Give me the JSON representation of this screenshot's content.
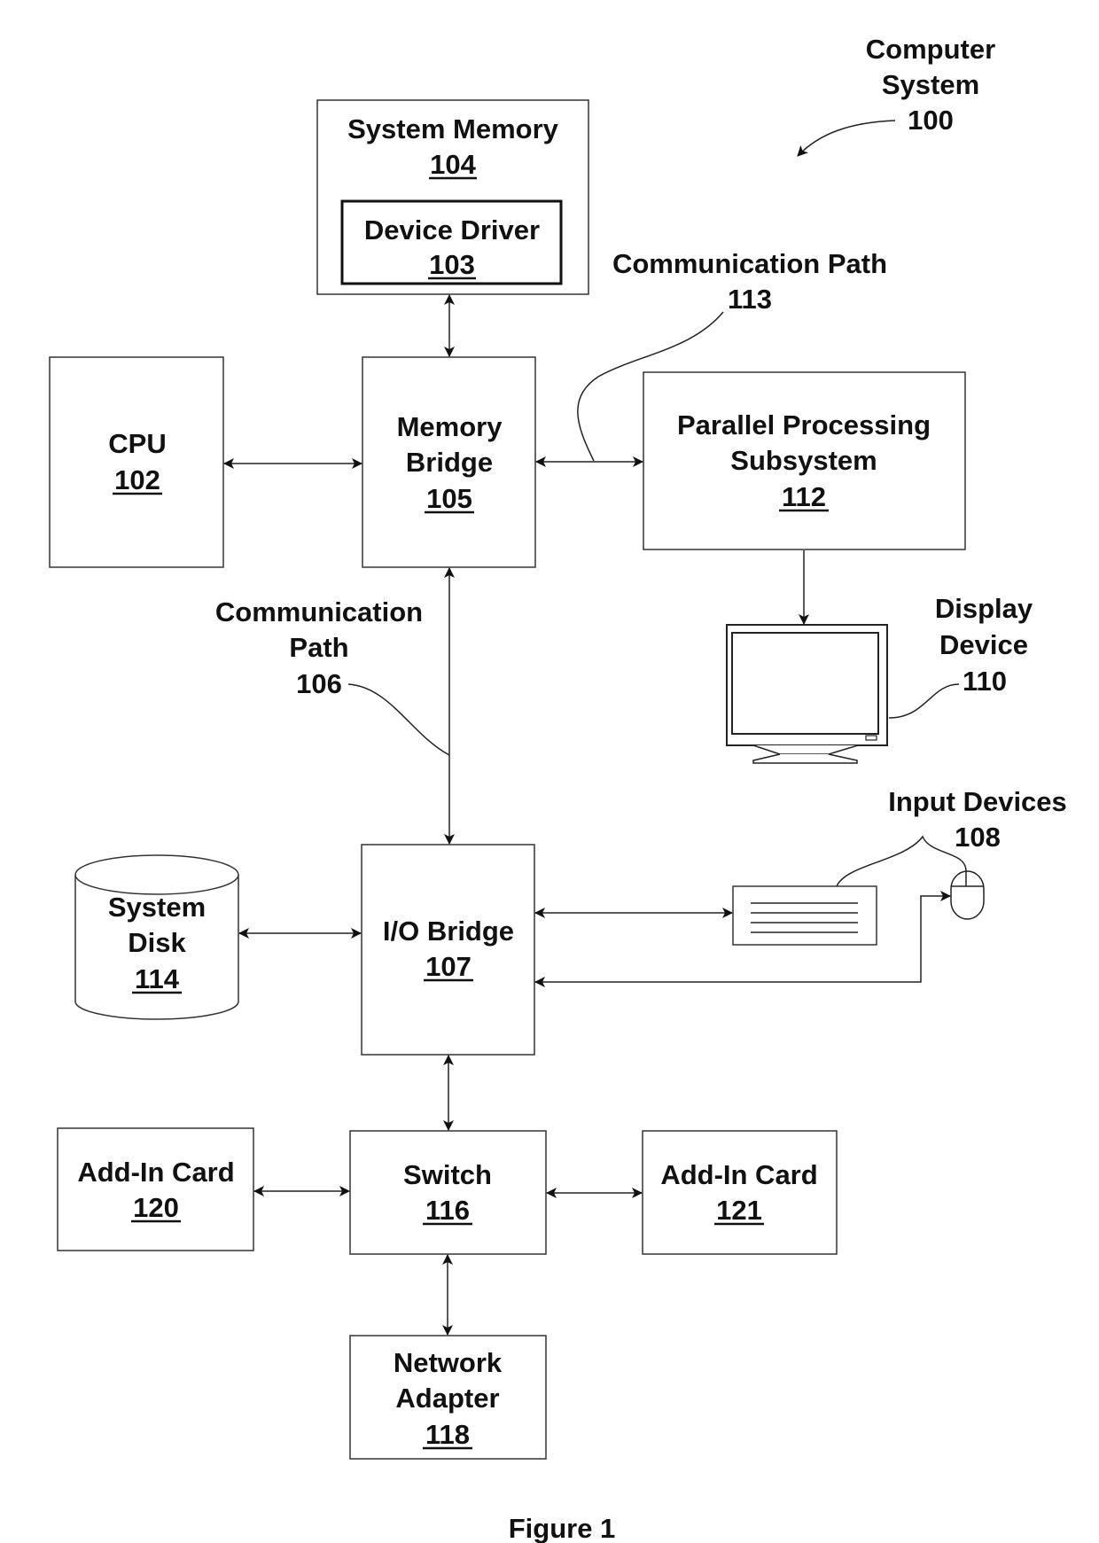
{
  "figure_caption": "Figure 1",
  "system_label": {
    "line1": "Computer",
    "line2": "System",
    "ref": "100"
  },
  "components": {
    "system_memory": {
      "name": "System Memory",
      "ref": "104"
    },
    "device_driver": {
      "name": "Device Driver",
      "ref": "103"
    },
    "cpu": {
      "name": "CPU",
      "ref": "102"
    },
    "memory_bridge": {
      "line1": "Memory",
      "line2": "Bridge",
      "ref": "105"
    },
    "parallel_processing": {
      "line1": "Parallel Processing",
      "line2": "Subsystem",
      "ref": "112"
    },
    "display_device": {
      "line1": "Display",
      "line2": "Device",
      "ref": "110"
    },
    "input_devices": {
      "name": "Input Devices",
      "ref": "108"
    },
    "io_bridge": {
      "name": "I/O Bridge",
      "ref": "107"
    },
    "system_disk": {
      "line1": "System",
      "line2": "Disk",
      "ref": "114"
    },
    "switch": {
      "name": "Switch",
      "ref": "116"
    },
    "add_in_card_120": {
      "name": "Add-In Card",
      "ref": "120"
    },
    "add_in_card_121": {
      "name": "Add-In Card",
      "ref": "121"
    },
    "network_adapter": {
      "line1": "Network",
      "line2": "Adapter",
      "ref": "118"
    }
  },
  "paths": {
    "path_113": {
      "name": "Communication Path",
      "ref": "113"
    },
    "path_106": {
      "line1": "Communication",
      "line2": "Path",
      "ref": "106"
    }
  },
  "connections": [
    {
      "from": "System Memory 104",
      "to": "Memory Bridge 105",
      "type": "bidirectional"
    },
    {
      "from": "CPU 102",
      "to": "Memory Bridge 105",
      "type": "bidirectional"
    },
    {
      "from": "Memory Bridge 105",
      "to": "Parallel Processing Subsystem 112",
      "type": "bidirectional",
      "label": "113"
    },
    {
      "from": "Parallel Processing Subsystem 112",
      "to": "Display Device 110",
      "type": "unidirectional"
    },
    {
      "from": "Memory Bridge 105",
      "to": "I/O Bridge 107",
      "type": "bidirectional",
      "label": "106"
    },
    {
      "from": "System Disk 114",
      "to": "I/O Bridge 107",
      "type": "bidirectional"
    },
    {
      "from": "I/O Bridge 107",
      "to": "Keyboard (Input Devices 108)",
      "type": "bidirectional"
    },
    {
      "from": "Mouse (Input Devices 108)",
      "to": "I/O Bridge 107",
      "type": "bidirectional"
    },
    {
      "from": "I/O Bridge 107",
      "to": "Switch 116",
      "type": "bidirectional"
    },
    {
      "from": "Add-In Card 120",
      "to": "Switch 116",
      "type": "bidirectional"
    },
    {
      "from": "Switch 116",
      "to": "Add-In Card 121",
      "type": "bidirectional"
    },
    {
      "from": "Switch 116",
      "to": "Network Adapter 118",
      "type": "bidirectional"
    }
  ]
}
